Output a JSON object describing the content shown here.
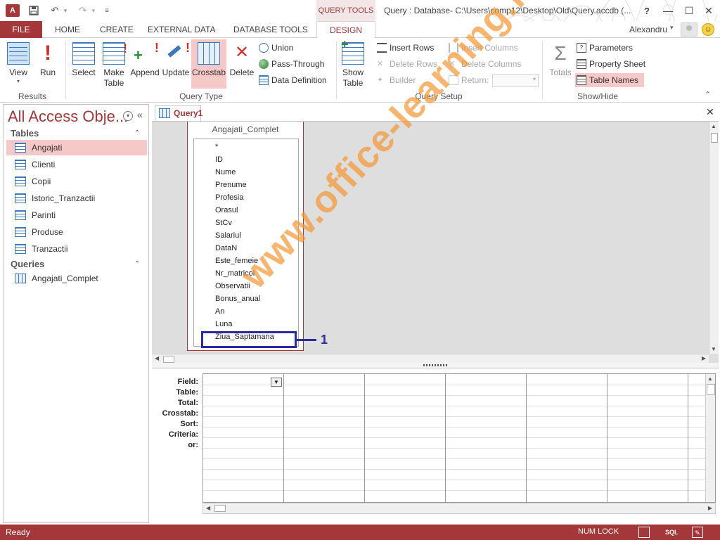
{
  "titlebar": {
    "app_logo": "A",
    "contextual_tab": "QUERY TOOLS",
    "window_title": "Query : Database- C:\\Users\\comp12\\Desktop\\Old\\Query.accdb (...",
    "help": "?"
  },
  "tabs": {
    "file": "FILE",
    "home": "HOME",
    "create": "CREATE",
    "external": "EXTERNAL DATA",
    "dbtools": "DATABASE TOOLS",
    "design": "DESIGN",
    "user": "Alexandru"
  },
  "ribbon": {
    "results": {
      "label": "Results",
      "view": "View",
      "run": "Run"
    },
    "query_type": {
      "label": "Query Type",
      "select": "Select",
      "make_table_1": "Make",
      "make_table_2": "Table",
      "append": "Append",
      "update": "Update",
      "crosstab": "Crosstab",
      "delete": "Delete",
      "union": "Union",
      "pass_through": "Pass-Through",
      "data_definition": "Data Definition"
    },
    "show_table": {
      "line1": "Show",
      "line2": "Table"
    },
    "query_setup": {
      "label": "Query Setup",
      "insert_rows": "Insert Rows",
      "delete_rows": "Delete Rows",
      "builder": "Builder",
      "insert_columns": "Insert Columns",
      "delete_columns": "Delete Columns",
      "return": "Return:"
    },
    "show_hide": {
      "label": "Show/Hide",
      "totals": "Totals",
      "parameters": "Parameters",
      "property_sheet": "Property Sheet",
      "table_names": "Table Names"
    }
  },
  "nav": {
    "title": "All Access Obje...",
    "tables_header": "Tables",
    "tables": [
      "Angajati",
      "Clienti",
      "Copii",
      "Istoric_Tranzactii",
      "Parinti",
      "Produse",
      "Tranzactii"
    ],
    "queries_header": "Queries",
    "queries": [
      "Angajati_Complet"
    ]
  },
  "doc": {
    "tab": "Query1",
    "table_title": "Angajati_Complet",
    "fields": [
      "*",
      "ID",
      "Nume",
      "Prenume",
      "Profesia",
      "Orasul",
      "StCv",
      "Salariul",
      "DataN",
      "Este_femeie",
      "Nr_matricol",
      "Observatii",
      "Bonus_anual",
      "An",
      "Luna",
      "Ziua_Saptamana"
    ],
    "callout_number": "1",
    "row_labels": [
      "Field:",
      "Table:",
      "Total:",
      "Crosstab:",
      "Sort:",
      "Criteria:",
      "or:"
    ]
  },
  "status": {
    "ready": "Ready",
    "numlock": "NUM LOCK",
    "sql": "SQL"
  },
  "watermark": "www.office-learning.ro",
  "colors": {
    "accent": "#a4373a",
    "highlight": "#f7c8c8",
    "callout": "#2b2ba0"
  }
}
